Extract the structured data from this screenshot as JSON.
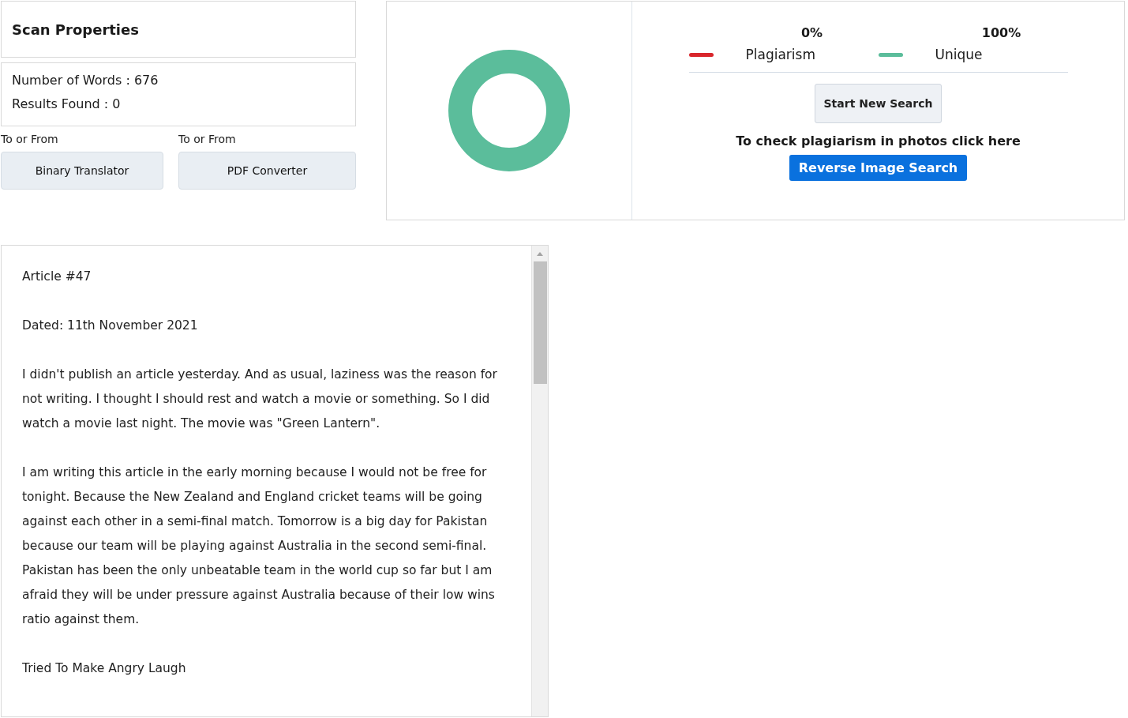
{
  "scan_properties": {
    "title": "Scan Properties",
    "stats": [
      {
        "label": "Number of Words : ",
        "value": "676"
      },
      {
        "label": "Results Found : ",
        "value": "0"
      }
    ]
  },
  "tools": [
    {
      "caption": "To or From",
      "button": "Binary Translator"
    },
    {
      "caption": "To or From",
      "button": "PDF Converter"
    }
  ],
  "result": {
    "legend": [
      {
        "percent": "0%",
        "label": "Plagiarism",
        "color": "#d9262c"
      },
      {
        "percent": "100%",
        "label": "Unique",
        "color": "#5bbd9b"
      }
    ],
    "new_search_button": "Start New Search",
    "photo_prompt": "To check plagiarism in photos click here",
    "reverse_image_button": "Reverse Image Search"
  },
  "article": {
    "paragraphs": [
      "Article #47",
      "Dated: 11th November 2021",
      "I didn't publish an article yesterday. And as usual, laziness was the reason for not writing. I thought I should rest and watch a movie or something. So I did watch a movie last night. The movie was \"Green Lantern\".",
      "I am writing this article in the early morning because I would not be free for tonight. Because the New Zealand and England cricket teams will be going against each other in a semi-final match. Tomorrow is a big day for Pakistan because our team will be playing against Australia in the second semi-final. Pakistan has been the only unbeatable team in the world cup so far but I am afraid they will be under pressure against Australia because of their low wins ratio against them.",
      "Tried To Make Angry Laugh"
    ]
  }
}
